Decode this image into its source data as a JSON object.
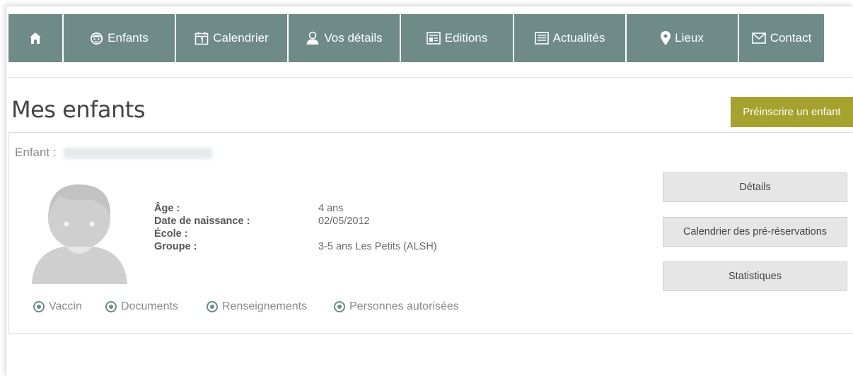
{
  "nav": {
    "home_icon": "home-icon",
    "items": [
      {
        "label": "Enfants",
        "icon": "child-face-icon"
      },
      {
        "label": "Calendrier",
        "icon": "calendar-icon"
      },
      {
        "label": "Vos détails",
        "icon": "user-icon"
      },
      {
        "label": "Editions",
        "icon": "document-icon"
      },
      {
        "label": "Actualités",
        "icon": "newspaper-icon"
      },
      {
        "label": "Lieux",
        "icon": "map-pin-icon"
      },
      {
        "label": "Contact",
        "icon": "envelope-icon"
      }
    ],
    "color": "#6e8b88"
  },
  "page": {
    "title": "Mes enfants",
    "preinscribe_label": "Préinscrire un enfant",
    "preinscribe_color": "#a5a22e"
  },
  "child": {
    "prefix": "Enfant :",
    "fields": [
      {
        "label": "Âge :",
        "value": "4 ans"
      },
      {
        "label": "Date de naissance :",
        "value": "02/05/2012"
      },
      {
        "label": "École :",
        "value": ""
      },
      {
        "label": "Groupe :",
        "value": "3-5 ans Les Petits (ALSH)"
      }
    ],
    "actions": [
      "Détails",
      "Calendrier des pré-réservations",
      "Statistiques"
    ],
    "links": [
      "Vaccin",
      "Documents",
      "Renseignements",
      "Personnes autorisées"
    ]
  }
}
